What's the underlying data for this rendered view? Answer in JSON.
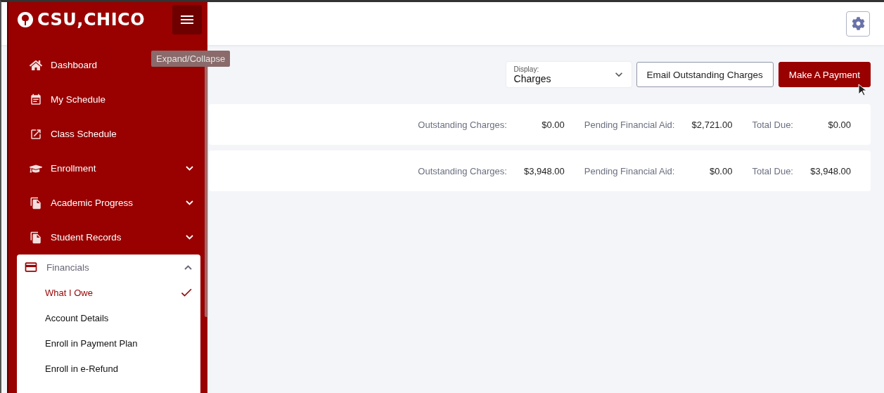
{
  "sidebar": {
    "logo": "CSU,CHICO",
    "menu_tooltip": "Expand/Collapse",
    "items": [
      {
        "label": "Dashboard",
        "kind": "link"
      },
      {
        "label": "My Schedule",
        "kind": "link"
      },
      {
        "label": "Class Schedule",
        "kind": "link"
      },
      {
        "label": "Enrollment",
        "kind": "group",
        "expanded": false
      },
      {
        "label": "Academic Progress",
        "kind": "group",
        "expanded": false
      },
      {
        "label": "Student Records",
        "kind": "group",
        "expanded": false
      },
      {
        "label": "Financials",
        "kind": "group",
        "expanded": true,
        "children": [
          {
            "label": "What I Owe",
            "selected": true
          },
          {
            "label": "Account Details",
            "selected": false
          },
          {
            "label": "Enroll in Payment Plan",
            "selected": false
          },
          {
            "label": "Enroll in e-Refund",
            "selected": false
          }
        ]
      }
    ]
  },
  "toolbar": {
    "display_label": "Display:",
    "display_value": "Charges",
    "buttons": [
      {
        "label": "Email Outstanding Charges",
        "kind": "outline"
      },
      {
        "label": "Make A Payment",
        "kind": "primary"
      }
    ]
  },
  "rows": [
    {
      "fields": [
        {
          "label": "Outstanding Charges:",
          "value": "$0.00"
        },
        {
          "label": "Pending Financial Aid:",
          "value": "$2,721.00"
        },
        {
          "label": "Total Due:",
          "value": "$0.00"
        }
      ]
    },
    {
      "fields": [
        {
          "label": "Outstanding Charges:",
          "value": "$3,948.00"
        },
        {
          "label": "Pending Financial Aid:",
          "value": "$0.00"
        },
        {
          "label": "Total Due:",
          "value": "$3,948.00"
        }
      ]
    }
  ]
}
